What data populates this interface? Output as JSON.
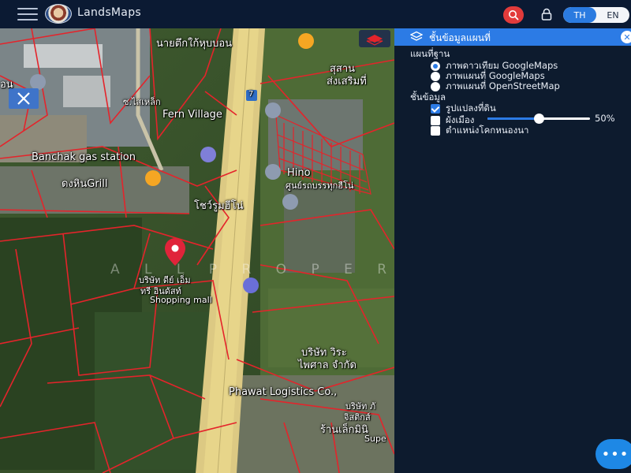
{
  "header": {
    "app_title": "LandsMaps",
    "lang_th": "TH",
    "lang_en": "EN",
    "active_lang": "TH"
  },
  "map": {
    "labels": {
      "top_center": "นายตึกใก้หุบบอน",
      "top_right_1": "สุสาน",
      "top_right_2": "ส่งเสริมที่",
      "left_edge": "อน",
      "fern_village": "Fern Village",
      "banchak": "Banchak gas station",
      "grill": "ดงหินGrill",
      "hino": "Hino",
      "hino_sub": "ศูนย์รถบรรทุกฮีโน่",
      "showroom": "โชว์รูมฮีโน่",
      "company_1": "บริษัท ดีย์ เอ็ม",
      "company_1b": "ทรี อินดัสท์",
      "shopping": "Shopping mall",
      "company_2": "บริษัท วิระ",
      "company_2b": "ไพศาล จำกัด",
      "phawat": "Phawat Logistics Co.,",
      "company_3": "บริษัท ภั",
      "company_3b": "จิสติกส์",
      "shop": "ร้านเล็กมินิ",
      "super": "Supe",
      "road_sign": "7",
      "left_small": "ซ.ไสเหล็ก"
    },
    "watermark": "A L L   P R O P E R T Y"
  },
  "panel": {
    "title": "ชั้นข้อมูลแผนที่",
    "basemap_title": "แผนที่ฐาน",
    "basemaps": [
      {
        "label": "ภาพดาวเทียม GoogleMaps",
        "selected": true
      },
      {
        "label": "ภาพแผนที่ GoogleMaps",
        "selected": false
      },
      {
        "label": "ภาพแผนที่ OpenStreetMap",
        "selected": false
      }
    ],
    "layers_title": "ชั้นข้อมูล",
    "layers": [
      {
        "label": "รูปแปลงที่ดิน",
        "checked": true
      },
      {
        "label": "ผังเมือง",
        "checked": false
      },
      {
        "label": "ตำแหน่งโคกหนองนา",
        "checked": false
      }
    ],
    "opacity": 0.5,
    "opacity_label": "50%"
  },
  "icons": {
    "menu": "hamburger-menu-icon",
    "search": "search-icon",
    "lock": "lock-icon",
    "layers": "layers-icon",
    "close": "close-icon",
    "more": "more-icon"
  },
  "colors": {
    "accent": "#2c7be5",
    "topbar": "#0b1a33",
    "panel": "#0d1b2e",
    "parcel": "#e4242b",
    "road": "#e7d58a"
  }
}
